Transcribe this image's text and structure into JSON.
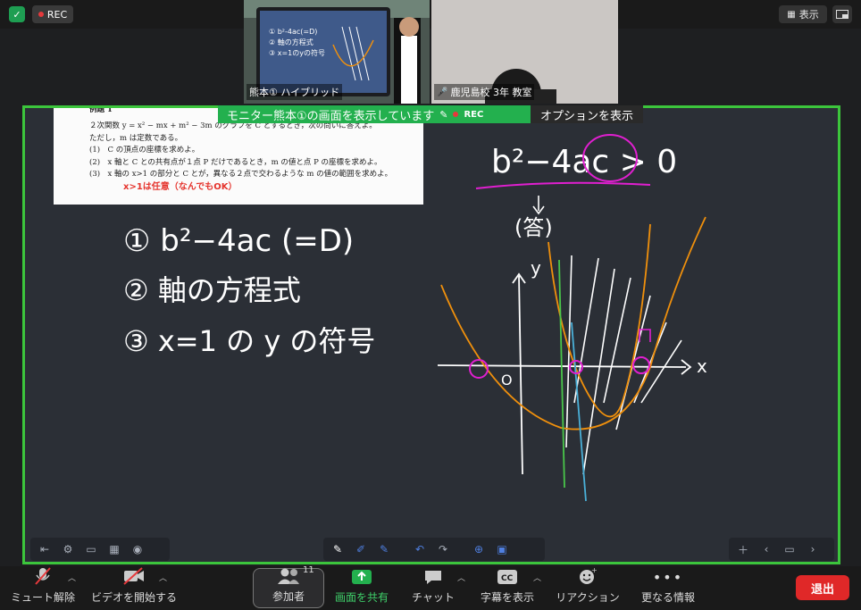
{
  "top_bar": {
    "rec_label": "REC",
    "view_label": "表示"
  },
  "tiles": [
    {
      "name": "熊本① ハイブリッド"
    },
    {
      "name": "鹿児島校 3年 教室"
    }
  ],
  "share_banner": {
    "text": "モニター熊本①の画面を表示しています",
    "rec_label": "REC",
    "option_label": "オプションを表示"
  },
  "document": {
    "title": "例題 1",
    "lines": [
      "２次関数 y = x² − mx + m² − 3m のグラフを C とするとき，次の問いに答えよ。",
      "ただし，m は定数である。",
      "(1)　C の頂点の座標を求めよ。",
      "(2)　x 軸と C との共有点が１点 P だけであるとき，m の値と点 P の座標を求めよ。",
      "(3)　x 軸の x>1 の部分と C とが，異なる２点で交わるような m の値の範囲を求めよ。"
    ],
    "annotation": "x>1は任意（なんでもOK）"
  },
  "whiteboard": {
    "handwriting": [
      "① b²−4ac (=D)",
      "② 軸の方程式",
      "③ x=1 の y の符号",
      "b²−4ac > 0",
      "(答)",
      "y",
      "x",
      "O"
    ],
    "left_tools": [
      "終了",
      "設定",
      "ファイル",
      "テンプレート",
      "ユーザー"
    ],
    "center_tools": [
      "ペン",
      "消しゴム",
      "図形",
      "元に戻す",
      "やり直す",
      "追加",
      "リセット"
    ],
    "right_tools": [
      "追加",
      "前へ",
      "ページ",
      "次へ"
    ],
    "colors": {
      "ink": "#ffffff",
      "orange": "#f0900c",
      "magenta": "#e01fd0",
      "green": "#49c64a",
      "blue": "#4ab0d8"
    }
  },
  "controls": {
    "mute": "ミュート解除",
    "video": "ビデオを開始する",
    "participants": "参加者",
    "participants_count": "11",
    "share": "画面を共有",
    "chat": "チャット",
    "captions": "字幕を表示",
    "reactions": "リアクション",
    "more": "更なる情報",
    "leave": "退出"
  }
}
